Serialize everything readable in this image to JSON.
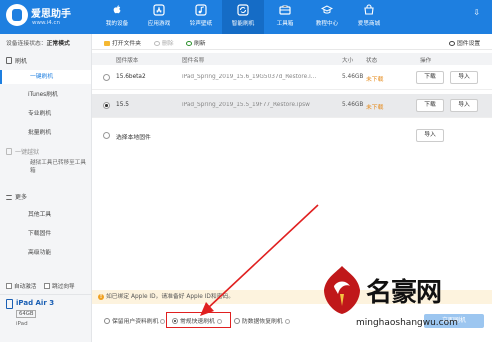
{
  "app": {
    "brand": "爱思助手",
    "url": "www.i4.cn",
    "nav": [
      {
        "label": "我的设备",
        "icon": "apple-icon"
      },
      {
        "label": "应用游戏",
        "icon": "app-store-icon"
      },
      {
        "label": "铃声壁纸",
        "icon": "music-icon"
      },
      {
        "label": "智能刷机",
        "icon": "flash-icon"
      },
      {
        "label": "工具箱",
        "icon": "toolbox-icon"
      },
      {
        "label": "教程中心",
        "icon": "tutorial-icon"
      },
      {
        "label": "爱思商城",
        "icon": "shop-icon"
      }
    ],
    "active_nav_index": 3
  },
  "sidebar": {
    "status_prefix": "设备连接状态：",
    "status_value": "正常模式",
    "group_flash": "刷机",
    "items_flash": [
      "一键刷机",
      "iTunes刷机",
      "专业刷机",
      "批量刷机"
    ],
    "group_jailbreak": "一键越狱",
    "jailbreak_note": "越狱工具已转移至工具箱",
    "group_more": "更多",
    "items_more": [
      "其他工具",
      "下载固件",
      "高级功能"
    ],
    "chk_auto_activate": "自动激活",
    "chk_skip_guide": "跳过向导",
    "device_name": "iPad Air 3",
    "device_capacity": "64GB",
    "device_type": "iPad"
  },
  "toolbar": {
    "open_folder": "打开文件夹",
    "delete": "删除",
    "refresh": "刷新",
    "settings": "固件设置"
  },
  "table": {
    "headers": {
      "version": "固件版本",
      "name": "固件名称",
      "size": "大小",
      "status": "状态",
      "action": "操作"
    },
    "rows": [
      {
        "version": "15.6beta2",
        "name": "iPad_Spring_2019_15.6_19G5037d_Restore.i...",
        "size": "5.46GB",
        "status": "未下载",
        "btn1": "下载",
        "btn2": "导入",
        "selected": false
      },
      {
        "version": "15.5",
        "name": "iPad_Spring_2019_15.5_19F77_Restore.ipsw",
        "size": "5.46GB",
        "status": "未下载",
        "btn1": "下载",
        "btn2": "导入",
        "selected": true
      }
    ],
    "local_label": "选择本地固件",
    "local_btn": "导入"
  },
  "bottom": {
    "warning": "如已绑定 Apple ID，请准备好 Apple ID和密码。",
    "mode_keep": "保留用户资料刷机",
    "mode_normal": "常规快速刷机",
    "mode_anti": "防数据恢复刷机",
    "flash_button": "立即刷机"
  },
  "watermark": {
    "text": "名豪网",
    "url": "minghaoshangwu.com"
  },
  "colors": {
    "topbar": "#1e7fe0",
    "accent": "#1e7fe0",
    "status_orange": "#e58a1a",
    "highlight_red": "#e02020"
  }
}
